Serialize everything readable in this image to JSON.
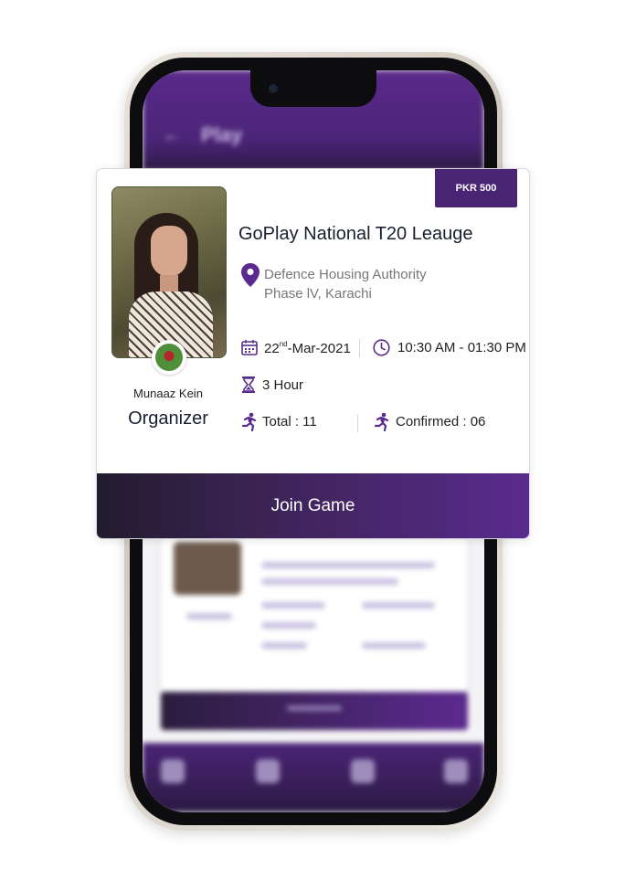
{
  "background_app": {
    "header_title": "Play",
    "back_glyph": "←"
  },
  "event": {
    "price": "PKR 500",
    "title": "GoPlay National T20 Leauge",
    "location_line1": "Defence Housing Authority",
    "location_line2": "Phase lV, Karachi",
    "date_day": "22",
    "date_suffix": "nd",
    "date_rest": "-Mar-2021",
    "time": "10:30 AM - 01:30 PM",
    "duration": "3 Hour",
    "total": "Total : 11",
    "confirmed": "Confirmed : 06"
  },
  "organizer": {
    "name": "Munaaz Kein",
    "role": "Organizer"
  },
  "actions": {
    "join_label": "Join Game"
  },
  "colors": {
    "brand_purple": "#5a2b8e",
    "dark": "#221b2d",
    "icon_purple": "#5a2b8e"
  },
  "icons": [
    "location-pin-icon",
    "calendar-icon",
    "clock-icon",
    "hourglass-icon",
    "running-person-icon",
    "cricket-ball-icon"
  ]
}
